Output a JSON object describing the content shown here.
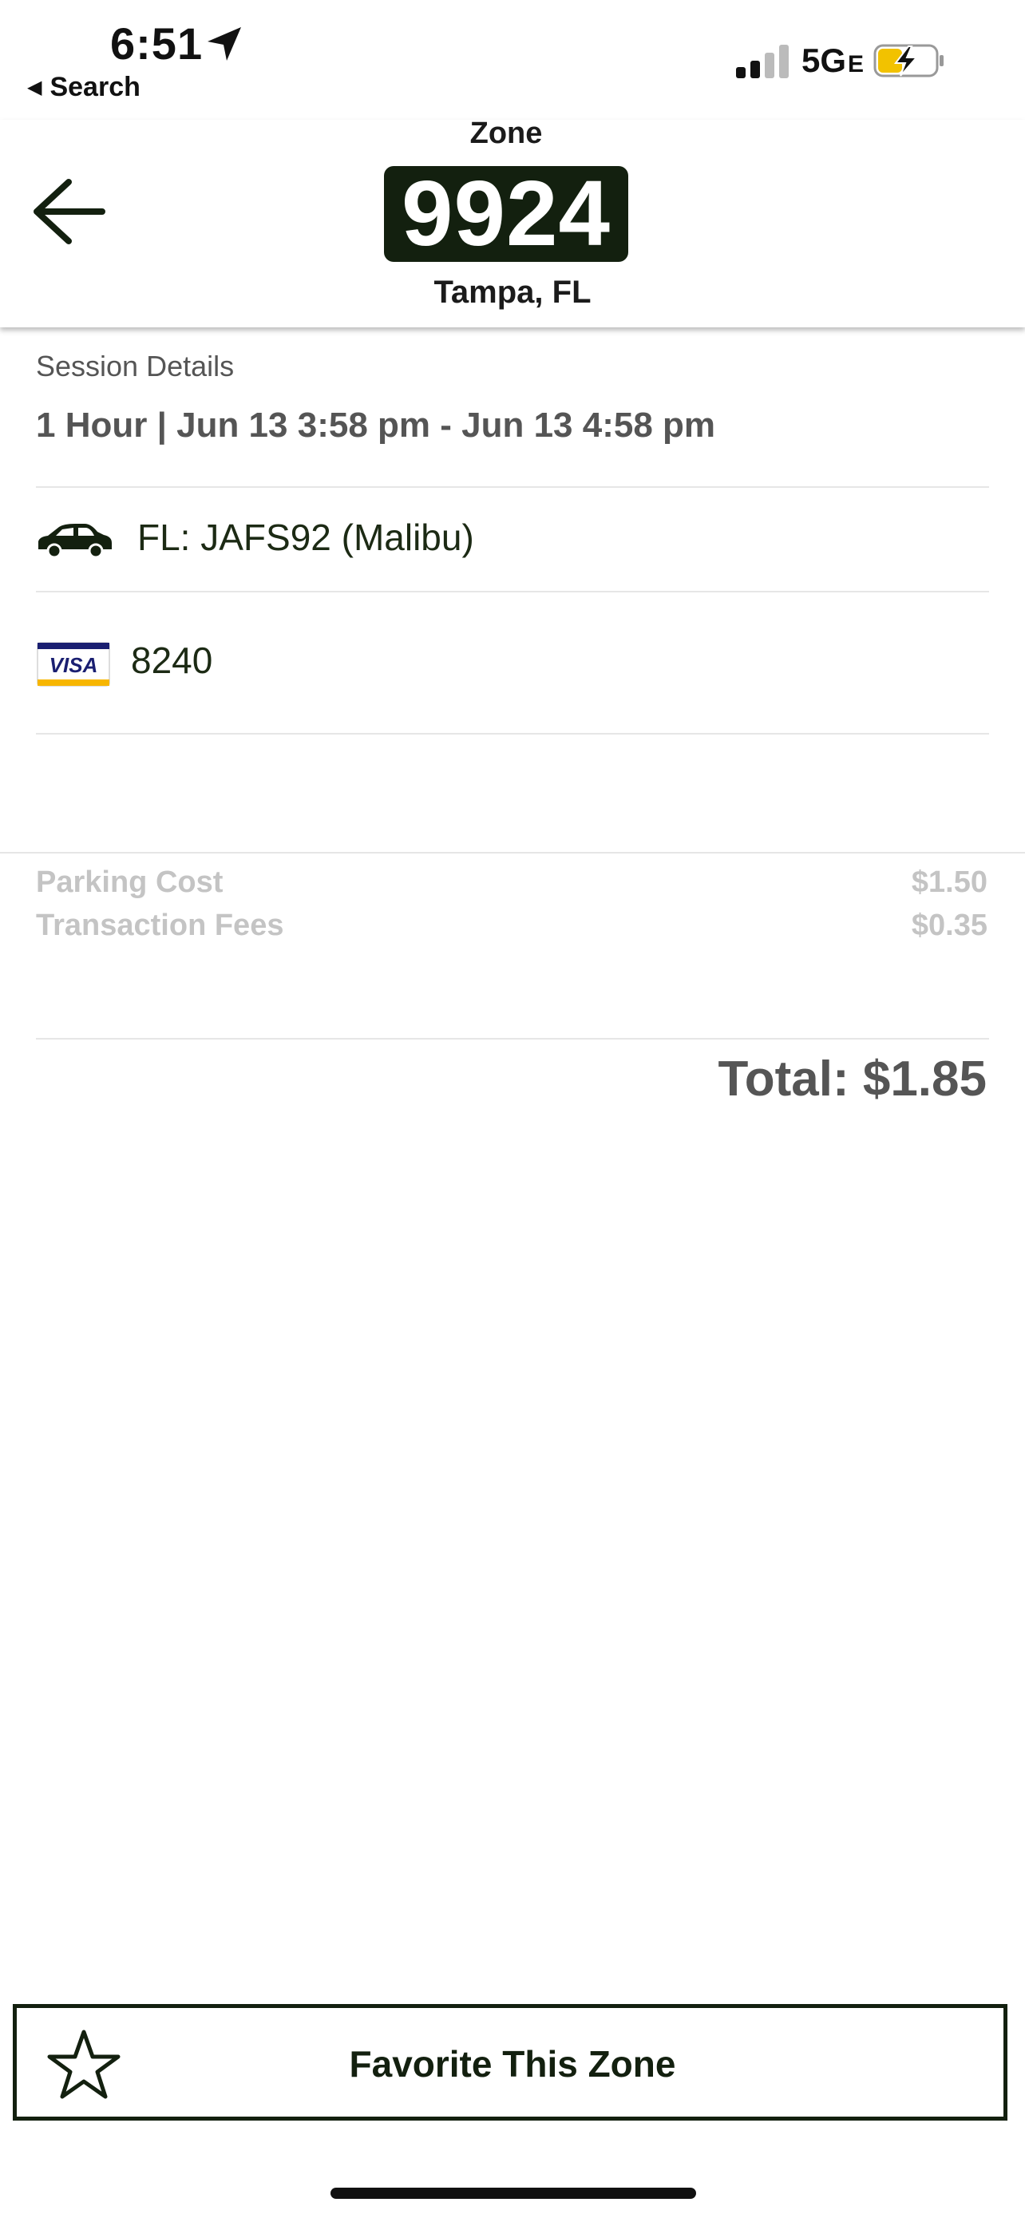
{
  "status_bar": {
    "time": "6:51",
    "back_app": "Search",
    "network": "5G",
    "network_suffix": "E",
    "battery_color": "#f2c200"
  },
  "header": {
    "zone_label": "Zone",
    "zone_number": "9924",
    "city": "Tampa, FL"
  },
  "session": {
    "title": "Session Details",
    "detail": "1 Hour | Jun 13 3:58 pm - Jun 13 4:58 pm",
    "vehicle": "FL: JAFS92 (Malibu)",
    "card_brand": "VISA",
    "card_last4": "8240"
  },
  "costs": [
    {
      "label": "Parking Cost",
      "value": "$1.50"
    },
    {
      "label": "Transaction Fees",
      "value": "$0.35"
    }
  ],
  "total": "Total: $1.85",
  "favorite_button": {
    "label": "Favorite This Zone"
  },
  "colors": {
    "brand_dark": "#13200f",
    "muted_text": "#555555",
    "light_text": "#c4c4c4"
  }
}
